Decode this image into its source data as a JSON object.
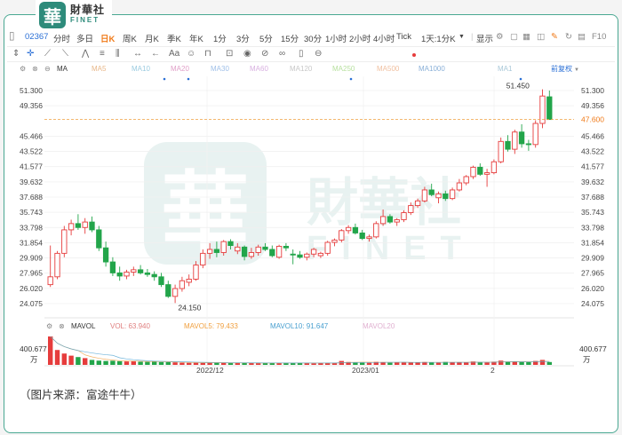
{
  "brand": {
    "cn": "財華社",
    "en": "FINET",
    "badge": "華"
  },
  "toolbar": {
    "code": "02367",
    "tabs": [
      "分时",
      "多日",
      "日K",
      "周K",
      "月K",
      "季K",
      "年K",
      "1分",
      "3分",
      "5分",
      "15分",
      "30分",
      "1小时",
      "2小时",
      "4小时",
      "Tick",
      "1天:1分K"
    ],
    "active": "日K",
    "display": "显示",
    "f10": "F10"
  },
  "ma_legend": {
    "prefix": "MA",
    "items": [
      "MA5",
      "MA10",
      "MA20",
      "MA30",
      "MA60",
      "MA120",
      "MA250",
      "MA500",
      "MA1000",
      "MA1"
    ],
    "adjust": "前复权"
  },
  "mavol_legend": {
    "prefix": "MAVOL",
    "vol": "VOL: 63.940",
    "ma5": "MAVOL5: 79.433",
    "ma10": "MAVOL10: 91.647",
    "ma20": "MAVOL20"
  },
  "price_axis": [
    "51.300",
    "49.356",
    "47.600",
    "45.466",
    "43.522",
    "41.577",
    "39.632",
    "37.688",
    "35.743",
    "33.798",
    "31.854",
    "29.909",
    "27.965",
    "26.020",
    "24.075"
  ],
  "current_price": "47.600",
  "annotations": {
    "high": "51.450",
    "low": "24.150"
  },
  "vol_axis": {
    "value": "400.677",
    "unit": "万"
  },
  "date_labels": [
    "2022/12",
    "2023/01",
    "2"
  ],
  "watermark": {
    "cn": "財華社",
    "en": "FINET",
    "badge": "華"
  },
  "source": "（图片来源：富途牛牛）",
  "colors": {
    "up": "#e63c3c",
    "down": "#22a54a",
    "accent": "#2e8b7b",
    "dash": "#f0a040"
  },
  "candles": [
    [
      26.5,
      31.5,
      26.2,
      27.5
    ],
    [
      27.5,
      30.8,
      27.2,
      30.5
    ],
    [
      30.5,
      34.0,
      30.0,
      33.5
    ],
    [
      33.5,
      34.8,
      32.8,
      34.3
    ],
    [
      34.3,
      35.5,
      33.5,
      33.8
    ],
    [
      33.8,
      35.0,
      33.0,
      34.5
    ],
    [
      34.5,
      35.2,
      33.2,
      33.5
    ],
    [
      33.5,
      34.0,
      30.8,
      31.2
    ],
    [
      31.2,
      32.0,
      28.8,
      29.4
    ],
    [
      29.4,
      30.0,
      27.6,
      28.0
    ],
    [
      28.0,
      28.8,
      27.0,
      27.6
    ],
    [
      27.6,
      28.4,
      27.2,
      28.1
    ],
    [
      28.1,
      28.8,
      27.6,
      28.4
    ],
    [
      28.4,
      29.0,
      27.8,
      28.0
    ],
    [
      28.0,
      28.5,
      27.5,
      27.8
    ],
    [
      27.8,
      28.2,
      27.0,
      27.5
    ],
    [
      27.5,
      28.0,
      26.2,
      26.5
    ],
    [
      26.5,
      27.0,
      24.8,
      25.0
    ],
    [
      25.0,
      26.5,
      24.15,
      26.0
    ],
    [
      26.0,
      27.5,
      25.6,
      27.0
    ],
    [
      26.8,
      27.8,
      26.3,
      27.2
    ],
    [
      27.2,
      29.5,
      27.0,
      29.0
    ],
    [
      29.0,
      31.0,
      28.6,
      30.5
    ],
    [
      30.5,
      31.8,
      29.8,
      31.0
    ],
    [
      31.0,
      32.0,
      30.0,
      30.6
    ],
    [
      30.6,
      32.2,
      30.2,
      32.0
    ],
    [
      32.0,
      32.3,
      31.0,
      31.5
    ],
    [
      30.8,
      31.8,
      30.4,
      31.3
    ],
    [
      31.3,
      31.5,
      29.6,
      30.1
    ],
    [
      30.1,
      31.2,
      29.8,
      30.6
    ],
    [
      30.6,
      31.6,
      30.2,
      31.3
    ],
    [
      31.3,
      31.8,
      30.8,
      31.0
    ],
    [
      31.0,
      31.5,
      30.0,
      30.2
    ],
    [
      30.0,
      31.6,
      29.8,
      31.4
    ],
    [
      31.4,
      31.8,
      30.8,
      31.2
    ],
    [
      30.4,
      31.0,
      29.1,
      30.3
    ],
    [
      30.3,
      30.8,
      29.8,
      30.0
    ],
    [
      30.0,
      30.6,
      29.6,
      30.4
    ],
    [
      30.4,
      31.2,
      30.0,
      31.0
    ],
    [
      30.2,
      30.7,
      29.9,
      30.5
    ],
    [
      30.5,
      32.1,
      30.2,
      31.9
    ],
    [
      31.9,
      32.4,
      31.4,
      32.2
    ],
    [
      32.2,
      33.6,
      31.9,
      33.4
    ],
    [
      33.4,
      34.1,
      33.0,
      33.8
    ],
    [
      33.8,
      34.3,
      32.9,
      33.1
    ],
    [
      33.1,
      33.5,
      32.2,
      32.4
    ],
    [
      32.4,
      32.9,
      32.0,
      32.6
    ],
    [
      32.6,
      34.6,
      32.4,
      34.3
    ],
    [
      34.3,
      36.1,
      34.0,
      35.2
    ],
    [
      35.2,
      35.5,
      34.3,
      34.5
    ],
    [
      34.5,
      35.0,
      34.0,
      34.8
    ],
    [
      34.8,
      36.0,
      34.5,
      35.7
    ],
    [
      35.7,
      37.0,
      35.4,
      36.6
    ],
    [
      36.6,
      37.5,
      36.3,
      37.2
    ],
    [
      37.2,
      39.0,
      37.0,
      38.6
    ],
    [
      38.6,
      39.4,
      37.8,
      38.0
    ],
    [
      37.6,
      38.4,
      36.9,
      38.1
    ],
    [
      38.1,
      38.5,
      37.2,
      37.5
    ],
    [
      37.5,
      38.9,
      37.3,
      38.6
    ],
    [
      38.6,
      40.0,
      38.4,
      39.5
    ],
    [
      39.5,
      40.5,
      39.2,
      40.3
    ],
    [
      40.3,
      41.7,
      40.0,
      41.5
    ],
    [
      41.5,
      42.0,
      40.4,
      40.6
    ],
    [
      40.6,
      41.3,
      39.0,
      40.8
    ],
    [
      40.8,
      42.5,
      40.6,
      42.2
    ],
    [
      42.2,
      45.3,
      42.0,
      44.8
    ],
    [
      44.8,
      45.6,
      43.5,
      43.8
    ],
    [
      43.8,
      46.3,
      43.2,
      46.0
    ],
    [
      46.0,
      47.0,
      44.0,
      44.5
    ],
    [
      44.5,
      45.0,
      43.6,
      44.4
    ],
    [
      44.4,
      47.5,
      44.0,
      47.1
    ],
    [
      47.1,
      51.45,
      46.5,
      50.6
    ],
    [
      50.5,
      51.3,
      47.6,
      47.6
    ]
  ],
  "volumes": [
    400.7,
    210,
    160,
    130,
    110,
    95,
    70,
    60,
    55,
    58,
    52,
    48,
    50,
    45,
    42,
    47,
    40,
    38,
    35,
    30,
    28,
    30,
    27,
    30,
    32,
    28,
    25,
    27,
    30,
    26,
    24,
    28,
    26,
    25,
    30,
    27,
    29,
    24,
    22,
    26,
    25,
    30,
    55,
    40,
    35,
    33,
    30,
    42,
    38,
    30,
    35,
    33,
    34,
    36,
    40,
    33,
    30,
    42,
    38,
    35,
    33,
    48,
    36,
    34,
    45,
    60,
    45,
    50,
    40,
    38,
    55,
    70,
    40
  ],
  "vol_up": [
    1,
    1,
    1,
    1,
    0,
    1,
    0,
    0,
    0,
    0,
    0,
    1,
    1,
    0,
    0,
    0,
    0,
    0,
    1,
    1,
    1,
    1,
    1,
    1,
    0,
    1,
    0,
    1,
    0,
    1,
    1,
    0,
    0,
    1,
    0,
    0,
    0,
    1,
    1,
    1,
    1,
    1,
    1,
    1,
    0,
    0,
    1,
    1,
    1,
    0,
    1,
    1,
    1,
    1,
    1,
    0,
    1,
    0,
    1,
    1,
    1,
    1,
    0,
    1,
    1,
    1,
    0,
    1,
    0,
    0,
    1,
    1,
    0
  ]
}
